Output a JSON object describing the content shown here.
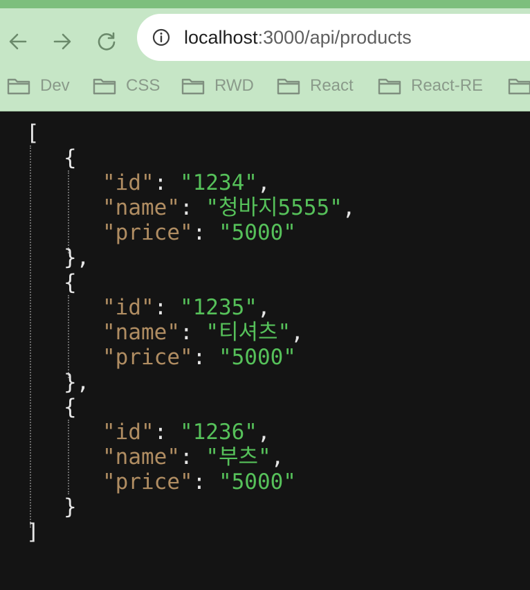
{
  "browser": {
    "url_host": "localhost",
    "url_rest": ":3000/api/products",
    "bookmarks": [
      "Dev",
      "CSS",
      "RWD",
      "React",
      "React-RE"
    ]
  },
  "icons": {
    "back": "arrow-left-icon",
    "forward": "arrow-right-icon",
    "reload": "reload-icon",
    "info": "info-circle-icon",
    "folder": "folder-icon"
  },
  "colors": {
    "chrome": "#c6e6c6",
    "top_strip": "#7dbf7d",
    "background": "#141414",
    "json_key": "#b08d62",
    "json_string": "#56c15a"
  },
  "json": {
    "open_bracket": "[",
    "close_bracket": "]",
    "open_brace": "{",
    "close_brace": "}",
    "close_brace_comma": "},",
    "colon": ": ",
    "comma": ",",
    "key_id": "\"id\"",
    "key_name": "\"name\"",
    "key_price": "\"price\"",
    "items": [
      {
        "id": "\"1234\"",
        "name": "\"청바지5555\"",
        "price": "\"5000\""
      },
      {
        "id": "\"1235\"",
        "name": "\"티셔츠\"",
        "price": "\"5000\""
      },
      {
        "id": "\"1236\"",
        "name": "\"부츠\"",
        "price": "\"5000\""
      }
    ]
  }
}
